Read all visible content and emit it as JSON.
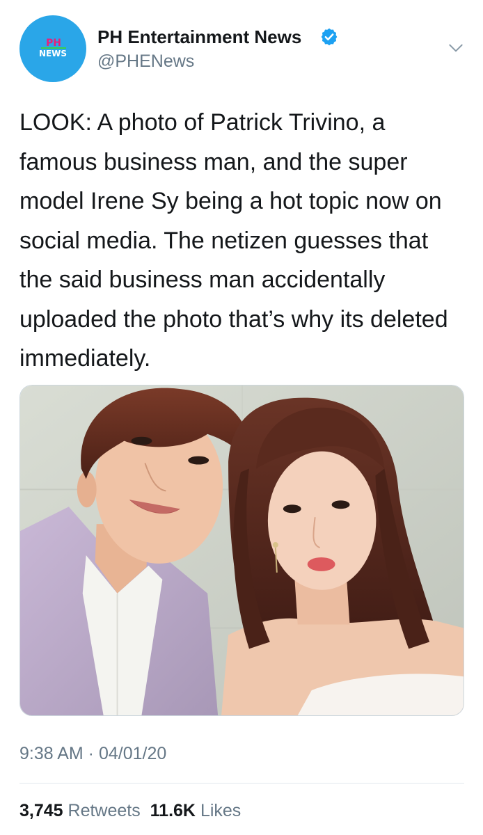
{
  "author": {
    "display_name": "PH Entertainment News",
    "handle": "@PHENews",
    "verified": true,
    "avatar": {
      "logo_top": "PH",
      "logo_bottom": "NEWS",
      "background_color": "#2aa6e8"
    }
  },
  "tweet": {
    "text": "LOOK: A photo of Patrick Trivino, a famous business man, and the super model Irene Sy being a hot topic now on social media. The netizen guesses that the said business man accidentally uploaded the photo that’s why its deleted immediately.",
    "timestamp": "9:38 AM · 04/01/20"
  },
  "stats": {
    "retweets_count": "3,745",
    "retweets_label": "Retweets",
    "likes_count": "11.6K",
    "likes_label": "Likes"
  },
  "icons": {
    "verified": "verified-badge-icon",
    "menu": "chevron-down-icon"
  },
  "colors": {
    "accent": "#1da1f2",
    "text_primary": "#14171a",
    "text_secondary": "#657786",
    "divider": "#e1e8ed"
  }
}
